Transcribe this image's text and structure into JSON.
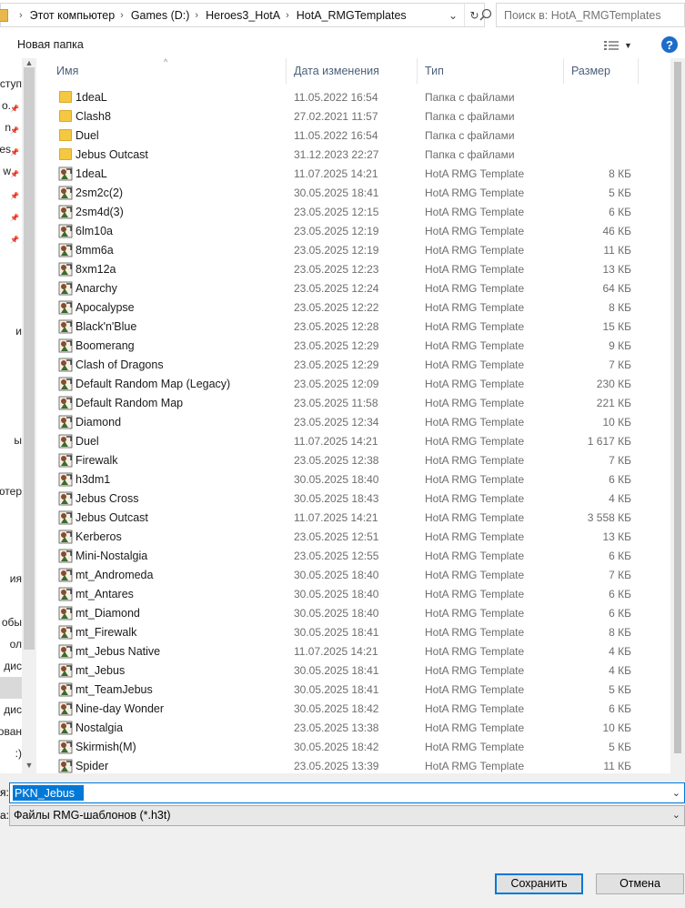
{
  "address": {
    "crumbs": [
      "Этот компьютер",
      "Games (D:)",
      "Heroes3_HotA",
      "HotA_RMGTemplates"
    ]
  },
  "search": {
    "placeholder": "Поиск в: HotA_RMGTemplates"
  },
  "toolbar": {
    "new_folder": "Новая папка"
  },
  "nav": {
    "items": [
      {
        "label": "ступ",
        "pinned": false
      },
      {
        "label": "о.",
        "pinned": true
      },
      {
        "label": "n",
        "pinned": true
      },
      {
        "label": "es",
        "pinned": true
      },
      {
        "label": "w",
        "pinned": true
      },
      {
        "label": "",
        "pinned": true
      },
      {
        "label": "",
        "pinned": true
      },
      {
        "label": "",
        "pinned": true
      },
      {
        "label": "и",
        "pinned": false
      },
      {
        "label": "ы",
        "pinned": false
      },
      {
        "label": "ютер",
        "pinned": false
      },
      {
        "label": "ия",
        "pinned": false
      },
      {
        "label": "обы",
        "pinned": false
      },
      {
        "label": "ол",
        "pinned": false
      },
      {
        "label": "дис",
        "pinned": false
      },
      {
        "label": "дис",
        "pinned": false
      },
      {
        "label": "ован",
        "pinned": false
      },
      {
        "label": ":)",
        "pinned": false
      }
    ]
  },
  "columns": {
    "name": "Имя",
    "date": "Дата изменения",
    "type": "Тип",
    "size": "Размер"
  },
  "files": [
    {
      "name": "1deaL",
      "date": "11.05.2022 16:54",
      "type": "Папка с файлами",
      "size": "",
      "kind": "folder"
    },
    {
      "name": "Clash8",
      "date": "27.02.2021 11:57",
      "type": "Папка с файлами",
      "size": "",
      "kind": "folder"
    },
    {
      "name": "Duel",
      "date": "11.05.2022 16:54",
      "type": "Папка с файлами",
      "size": "",
      "kind": "folder"
    },
    {
      "name": "Jebus Outcast",
      "date": "31.12.2023 22:27",
      "type": "Папка с файлами",
      "size": "",
      "kind": "folder"
    },
    {
      "name": "1deaL",
      "date": "11.07.2025 14:21",
      "type": "HotA RMG Template",
      "size": "8 КБ",
      "kind": "template"
    },
    {
      "name": "2sm2c(2)",
      "date": "30.05.2025 18:41",
      "type": "HotA RMG Template",
      "size": "5 КБ",
      "kind": "template"
    },
    {
      "name": "2sm4d(3)",
      "date": "23.05.2025 12:15",
      "type": "HotA RMG Template",
      "size": "6 КБ",
      "kind": "template"
    },
    {
      "name": "6lm10a",
      "date": "23.05.2025 12:19",
      "type": "HotA RMG Template",
      "size": "46 КБ",
      "kind": "template"
    },
    {
      "name": "8mm6a",
      "date": "23.05.2025 12:19",
      "type": "HotA RMG Template",
      "size": "11 КБ",
      "kind": "template"
    },
    {
      "name": "8xm12a",
      "date": "23.05.2025 12:23",
      "type": "HotA RMG Template",
      "size": "13 КБ",
      "kind": "template"
    },
    {
      "name": "Anarchy",
      "date": "23.05.2025 12:24",
      "type": "HotA RMG Template",
      "size": "64 КБ",
      "kind": "template"
    },
    {
      "name": "Apocalypse",
      "date": "23.05.2025 12:22",
      "type": "HotA RMG Template",
      "size": "8 КБ",
      "kind": "template"
    },
    {
      "name": "Black'n'Blue",
      "date": "23.05.2025 12:28",
      "type": "HotA RMG Template",
      "size": "15 КБ",
      "kind": "template"
    },
    {
      "name": "Boomerang",
      "date": "23.05.2025 12:29",
      "type": "HotA RMG Template",
      "size": "9 КБ",
      "kind": "template"
    },
    {
      "name": "Clash of Dragons",
      "date": "23.05.2025 12:29",
      "type": "HotA RMG Template",
      "size": "7 КБ",
      "kind": "template"
    },
    {
      "name": "Default Random Map (Legacy)",
      "date": "23.05.2025 12:09",
      "type": "HotA RMG Template",
      "size": "230 КБ",
      "kind": "template"
    },
    {
      "name": "Default Random Map",
      "date": "23.05.2025 11:58",
      "type": "HotA RMG Template",
      "size": "221 КБ",
      "kind": "template"
    },
    {
      "name": "Diamond",
      "date": "23.05.2025 12:34",
      "type": "HotA RMG Template",
      "size": "10 КБ",
      "kind": "template"
    },
    {
      "name": "Duel",
      "date": "11.07.2025 14:21",
      "type": "HotA RMG Template",
      "size": "1 617 КБ",
      "kind": "template"
    },
    {
      "name": "Firewalk",
      "date": "23.05.2025 12:38",
      "type": "HotA RMG Template",
      "size": "7 КБ",
      "kind": "template"
    },
    {
      "name": "h3dm1",
      "date": "30.05.2025 18:40",
      "type": "HotA RMG Template",
      "size": "6 КБ",
      "kind": "template"
    },
    {
      "name": "Jebus Cross",
      "date": "30.05.2025 18:43",
      "type": "HotA RMG Template",
      "size": "4 КБ",
      "kind": "template"
    },
    {
      "name": "Jebus Outcast",
      "date": "11.07.2025 14:21",
      "type": "HotA RMG Template",
      "size": "3 558 КБ",
      "kind": "template"
    },
    {
      "name": "Kerberos",
      "date": "23.05.2025 12:51",
      "type": "HotA RMG Template",
      "size": "13 КБ",
      "kind": "template"
    },
    {
      "name": "Mini-Nostalgia",
      "date": "23.05.2025 12:55",
      "type": "HotA RMG Template",
      "size": "6 КБ",
      "kind": "template"
    },
    {
      "name": "mt_Andromeda",
      "date": "30.05.2025 18:40",
      "type": "HotA RMG Template",
      "size": "7 КБ",
      "kind": "template"
    },
    {
      "name": "mt_Antares",
      "date": "30.05.2025 18:40",
      "type": "HotA RMG Template",
      "size": "6 КБ",
      "kind": "template"
    },
    {
      "name": "mt_Diamond",
      "date": "30.05.2025 18:40",
      "type": "HotA RMG Template",
      "size": "6 КБ",
      "kind": "template"
    },
    {
      "name": "mt_Firewalk",
      "date": "30.05.2025 18:41",
      "type": "HotA RMG Template",
      "size": "8 КБ",
      "kind": "template"
    },
    {
      "name": "mt_Jebus Native",
      "date": "11.07.2025 14:21",
      "type": "HotA RMG Template",
      "size": "4 КБ",
      "kind": "template"
    },
    {
      "name": "mt_Jebus",
      "date": "30.05.2025 18:41",
      "type": "HotA RMG Template",
      "size": "4 КБ",
      "kind": "template"
    },
    {
      "name": "mt_TeamJebus",
      "date": "30.05.2025 18:41",
      "type": "HotA RMG Template",
      "size": "5 КБ",
      "kind": "template"
    },
    {
      "name": "Nine-day Wonder",
      "date": "30.05.2025 18:42",
      "type": "HotA RMG Template",
      "size": "6 КБ",
      "kind": "template"
    },
    {
      "name": "Nostalgia",
      "date": "23.05.2025 13:38",
      "type": "HotA RMG Template",
      "size": "10 КБ",
      "kind": "template"
    },
    {
      "name": "Skirmish(M)",
      "date": "30.05.2025 18:42",
      "type": "HotA RMG Template",
      "size": "5 КБ",
      "kind": "template"
    },
    {
      "name": "Spider",
      "date": "23.05.2025 13:39",
      "type": "HotA RMG Template",
      "size": "11 КБ",
      "kind": "template"
    }
  ],
  "form": {
    "filename_label": "я:",
    "filename_value": "PKN_Jebus",
    "filetype_label": "а:",
    "filetype_value": "Файлы RMG-шаблонов (*.h3t)",
    "save": "Сохранить",
    "cancel": "Отмена"
  },
  "colors": {
    "accent": "#0078d7",
    "folder": "#f5c842",
    "header_text": "#4c607a"
  }
}
